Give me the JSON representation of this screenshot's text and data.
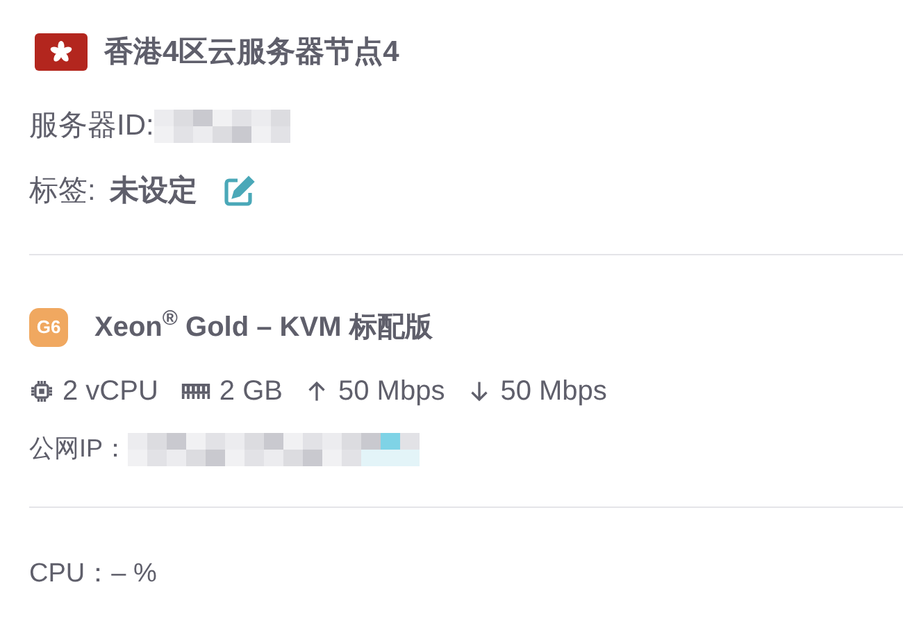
{
  "server": {
    "name": "香港4区云服务器节点4",
    "id_label": "服务器ID:",
    "tag_label": "标签:",
    "tag_value": "未设定"
  },
  "plan": {
    "badge": "G6",
    "title": "Xeon$^{®}$ Gold – KVM 标配版",
    "specs": [
      {
        "kind": "cpu",
        "text": "2 vCPU"
      },
      {
        "kind": "memory",
        "text": "2 GB"
      },
      {
        "kind": "upload",
        "text": "50 Mbps"
      },
      {
        "kind": "download",
        "text": "50 Mbps"
      }
    ],
    "ip_label": "公网IP："
  },
  "usage": {
    "cpu_label": "CPU：",
    "cpu_value": "– %"
  }
}
